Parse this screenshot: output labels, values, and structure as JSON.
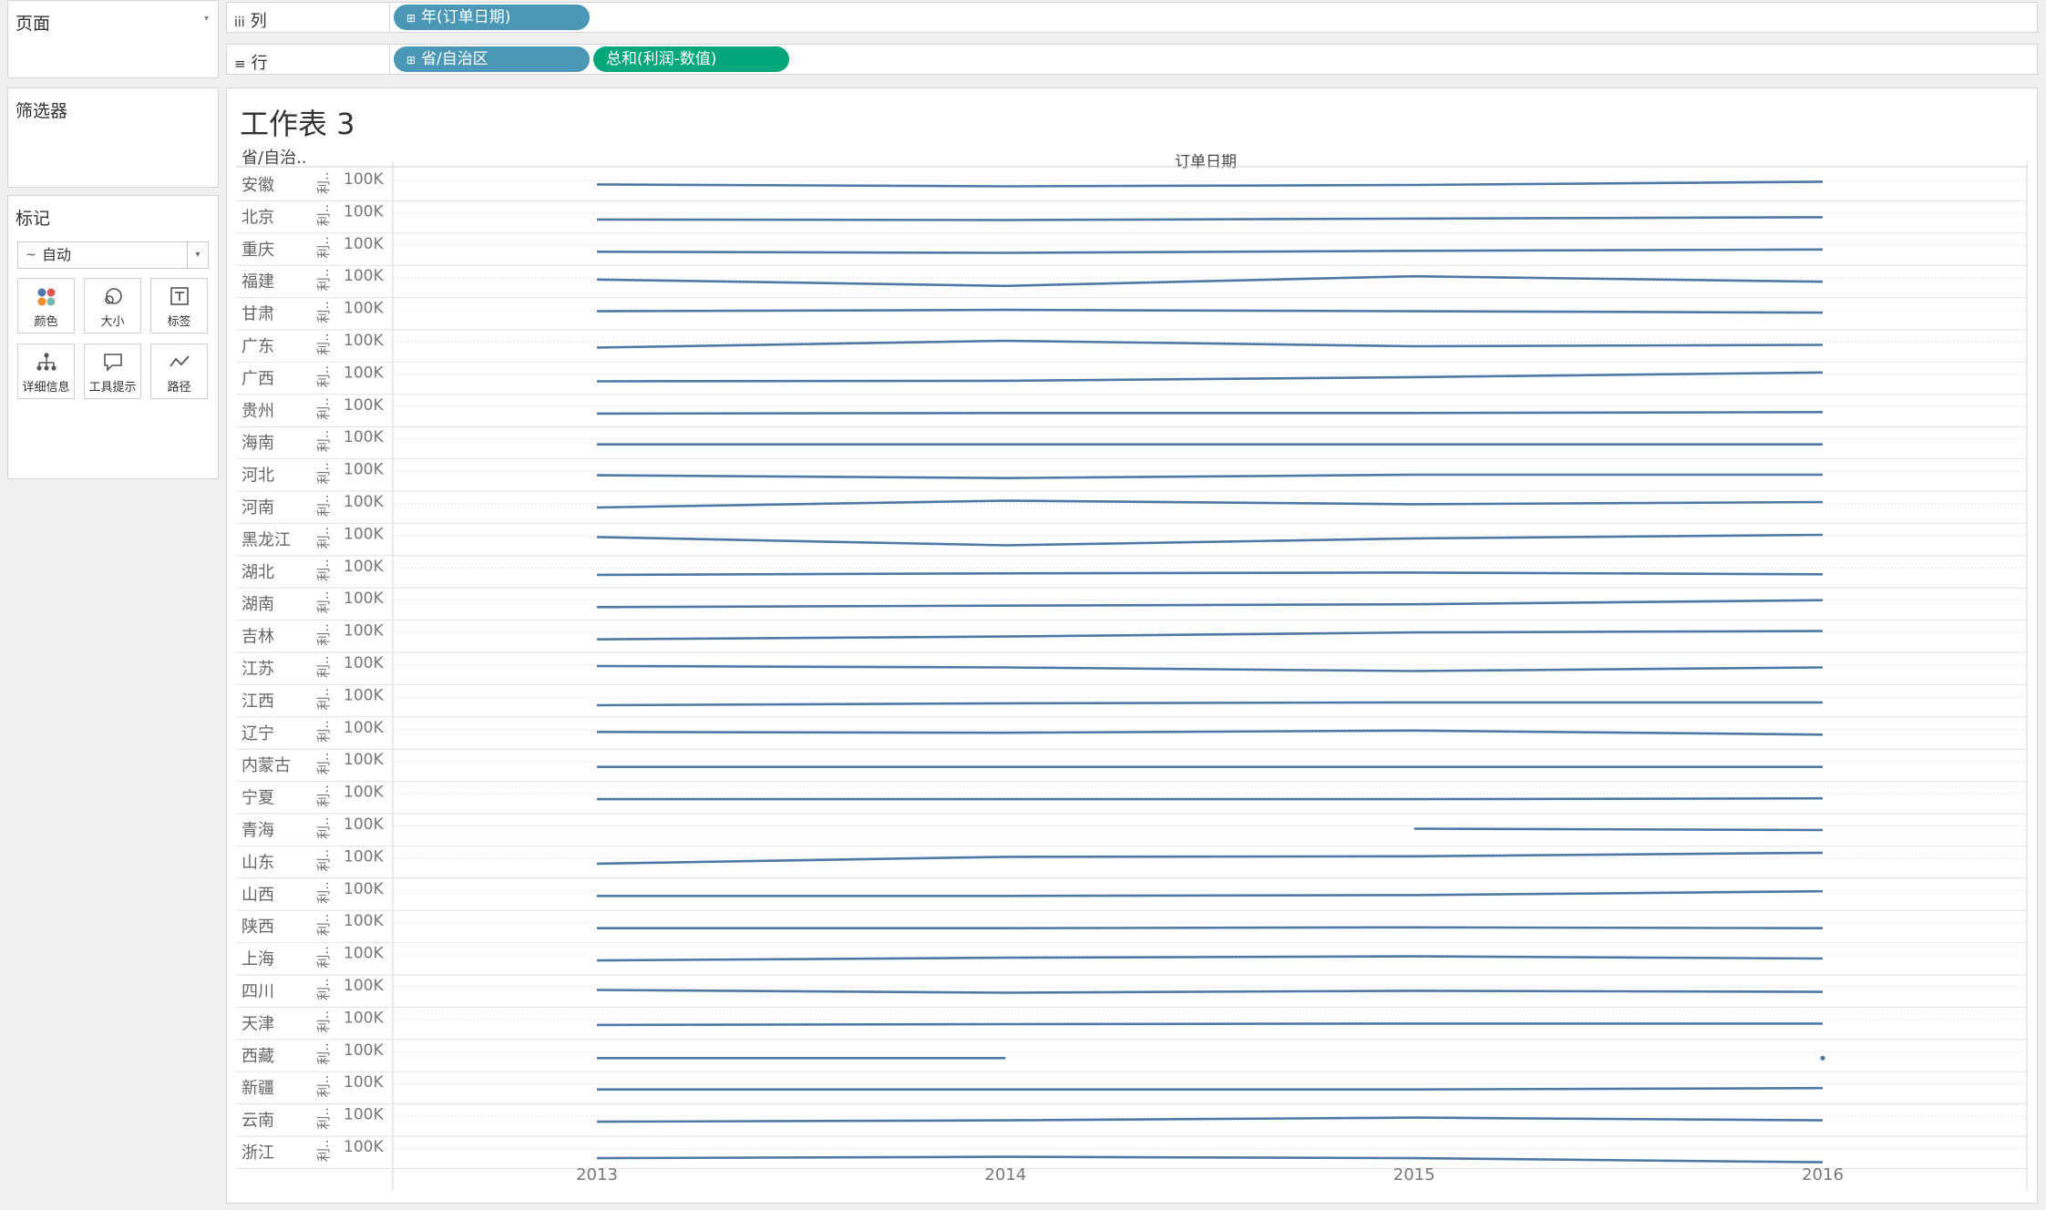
{
  "left_panels": {
    "pages_title": "页面",
    "filters_title": "筛选器",
    "marks_title": "标记",
    "marks_type": "自动",
    "mark_buttons": [
      {
        "icon": "color-dots-icon",
        "label": "颜色"
      },
      {
        "icon": "size-icon",
        "label": "大小"
      },
      {
        "icon": "label-T-icon",
        "label": "标签"
      },
      {
        "icon": "detail-tree-icon",
        "label": "详细信息"
      },
      {
        "icon": "tooltip-bubble-icon",
        "label": "工具提示"
      },
      {
        "icon": "path-icon",
        "label": "路径"
      }
    ]
  },
  "shelves": {
    "columns_label": "列",
    "rows_label": "行",
    "columns_pills": [
      {
        "prefix": "⊞",
        "text": "年(订单日期)",
        "kind": "dimension"
      }
    ],
    "rows_pills": [
      {
        "prefix": "⊞",
        "text": "省/自治区",
        "kind": "dimension"
      },
      {
        "prefix": "",
        "text": "总和(利润-数值)",
        "kind": "measure"
      }
    ]
  },
  "colors": {
    "line": "#4e79a7",
    "dimension_pill": "#4a98b6",
    "measure_pill": "#03a77b"
  },
  "sheet": {
    "title": "工作表 3",
    "row_header": "省/自治..",
    "column_header": "订单日期"
  },
  "chart_data": {
    "type": "line",
    "x": [
      "2013",
      "2014",
      "2015",
      "2016"
    ],
    "row_axis_unit": "利..",
    "row_axis_tick": "100K",
    "rows": [
      {
        "province": "安徽",
        "values": [
          0.52,
          0.45,
          0.5,
          0.62
        ]
      },
      {
        "province": "北京",
        "values": [
          0.42,
          0.4,
          0.45,
          0.5
        ]
      },
      {
        "province": "重庆",
        "values": [
          0.42,
          0.38,
          0.45,
          0.5
        ]
      },
      {
        "province": "福建",
        "values": [
          0.58,
          0.35,
          0.7,
          0.5
        ]
      },
      {
        "province": "甘肃",
        "values": [
          0.6,
          0.65,
          0.6,
          0.55
        ]
      },
      {
        "province": "广东",
        "values": [
          0.45,
          0.7,
          0.5,
          0.55
        ]
      },
      {
        "province": "广西",
        "values": [
          0.4,
          0.42,
          0.55,
          0.72
        ]
      },
      {
        "province": "贵州",
        "values": [
          0.4,
          0.42,
          0.42,
          0.45
        ]
      },
      {
        "province": "海南",
        "values": [
          0.45,
          0.45,
          0.45,
          0.45
        ]
      },
      {
        "province": "河北",
        "values": [
          0.5,
          0.4,
          0.52,
          0.52
        ]
      },
      {
        "province": "河南",
        "values": [
          0.5,
          0.75,
          0.62,
          0.7
        ]
      },
      {
        "province": "黑龙江",
        "values": [
          0.6,
          0.3,
          0.55,
          0.68
        ]
      },
      {
        "province": "湖北",
        "values": [
          0.4,
          0.45,
          0.48,
          0.42
        ]
      },
      {
        "province": "湖南",
        "values": [
          0.4,
          0.45,
          0.5,
          0.65
        ]
      },
      {
        "province": "吉林",
        "values": [
          0.4,
          0.5,
          0.65,
          0.7
        ]
      },
      {
        "province": "江苏",
        "values": [
          0.6,
          0.55,
          0.42,
          0.55
        ]
      },
      {
        "province": "江西",
        "values": [
          0.35,
          0.42,
          0.45,
          0.45
        ]
      },
      {
        "province": "辽宁",
        "values": [
          0.55,
          0.52,
          0.6,
          0.45
        ]
      },
      {
        "province": "内蒙古",
        "values": [
          0.45,
          0.45,
          0.45,
          0.45
        ]
      },
      {
        "province": "宁夏",
        "values": [
          0.45,
          0.45,
          0.45,
          0.48
        ]
      },
      {
        "province": "青海",
        "values": [
          null,
          null,
          0.55,
          0.5
        ]
      },
      {
        "province": "山东",
        "values": [
          0.45,
          0.7,
          0.72,
          0.85
        ]
      },
      {
        "province": "山西",
        "values": [
          0.45,
          0.45,
          0.48,
          0.62
        ]
      },
      {
        "province": "陕西",
        "values": [
          0.45,
          0.45,
          0.48,
          0.45
        ]
      },
      {
        "province": "上海",
        "values": [
          0.45,
          0.55,
          0.6,
          0.52
        ]
      },
      {
        "province": "四川",
        "values": [
          0.55,
          0.45,
          0.52,
          0.48
        ]
      },
      {
        "province": "天津",
        "values": [
          0.45,
          0.48,
          0.5,
          0.5
        ]
      },
      {
        "province": "西藏",
        "values": [
          0.42,
          0.42,
          null,
          0.42
        ]
      },
      {
        "province": "新疆",
        "values": [
          0.45,
          0.45,
          0.45,
          0.5
        ]
      },
      {
        "province": "云南",
        "values": [
          0.45,
          0.5,
          0.6,
          0.5
        ]
      },
      {
        "province": "浙江",
        "values": [
          0.3,
          0.35,
          0.3,
          0.15
        ]
      }
    ]
  }
}
